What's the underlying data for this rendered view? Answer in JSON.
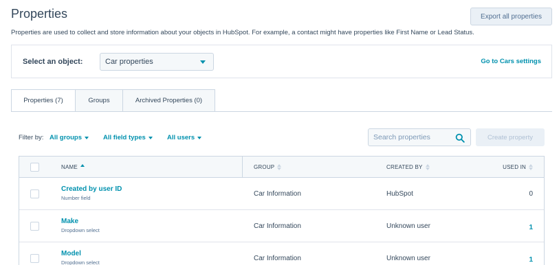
{
  "page": {
    "title": "Properties",
    "export_label": "Export all properties",
    "description": "Properties are used to collect and store information about your objects in HubSpot. For example, a contact might have properties like First Name or Lead Status."
  },
  "object_selector": {
    "label": "Select an object:",
    "selected": "Car properties",
    "settings_link": "Go to Cars settings"
  },
  "tabs": [
    {
      "label": "Properties (7)",
      "active": true
    },
    {
      "label": "Groups",
      "active": false
    },
    {
      "label": "Archived Properties (0)",
      "active": false
    }
  ],
  "filters": {
    "label": "Filter by:",
    "groups": "All groups",
    "field_types": "All field types",
    "users": "All users"
  },
  "search": {
    "placeholder": "Search properties",
    "icon": "search-icon"
  },
  "create_label": "Create property",
  "table": {
    "columns": {
      "name": "NAME",
      "group": "GROUP",
      "created_by": "CREATED BY",
      "used_in": "USED IN"
    },
    "rows": [
      {
        "name": "Created by user ID",
        "type": "Number field",
        "group": "Car Information",
        "created_by": "HubSpot",
        "used_in": "0"
      },
      {
        "name": "Make",
        "type": "Dropdown select",
        "group": "Car Information",
        "created_by": "Unknown user",
        "used_in": "1"
      },
      {
        "name": "Model",
        "type": "Dropdown select",
        "group": "Car Information",
        "created_by": "Unknown user",
        "used_in": "1"
      }
    ]
  },
  "colors": {
    "accent": "#0091ae",
    "text": "#33475b",
    "border": "#cbd6e2",
    "surface": "#f5f8fa"
  }
}
